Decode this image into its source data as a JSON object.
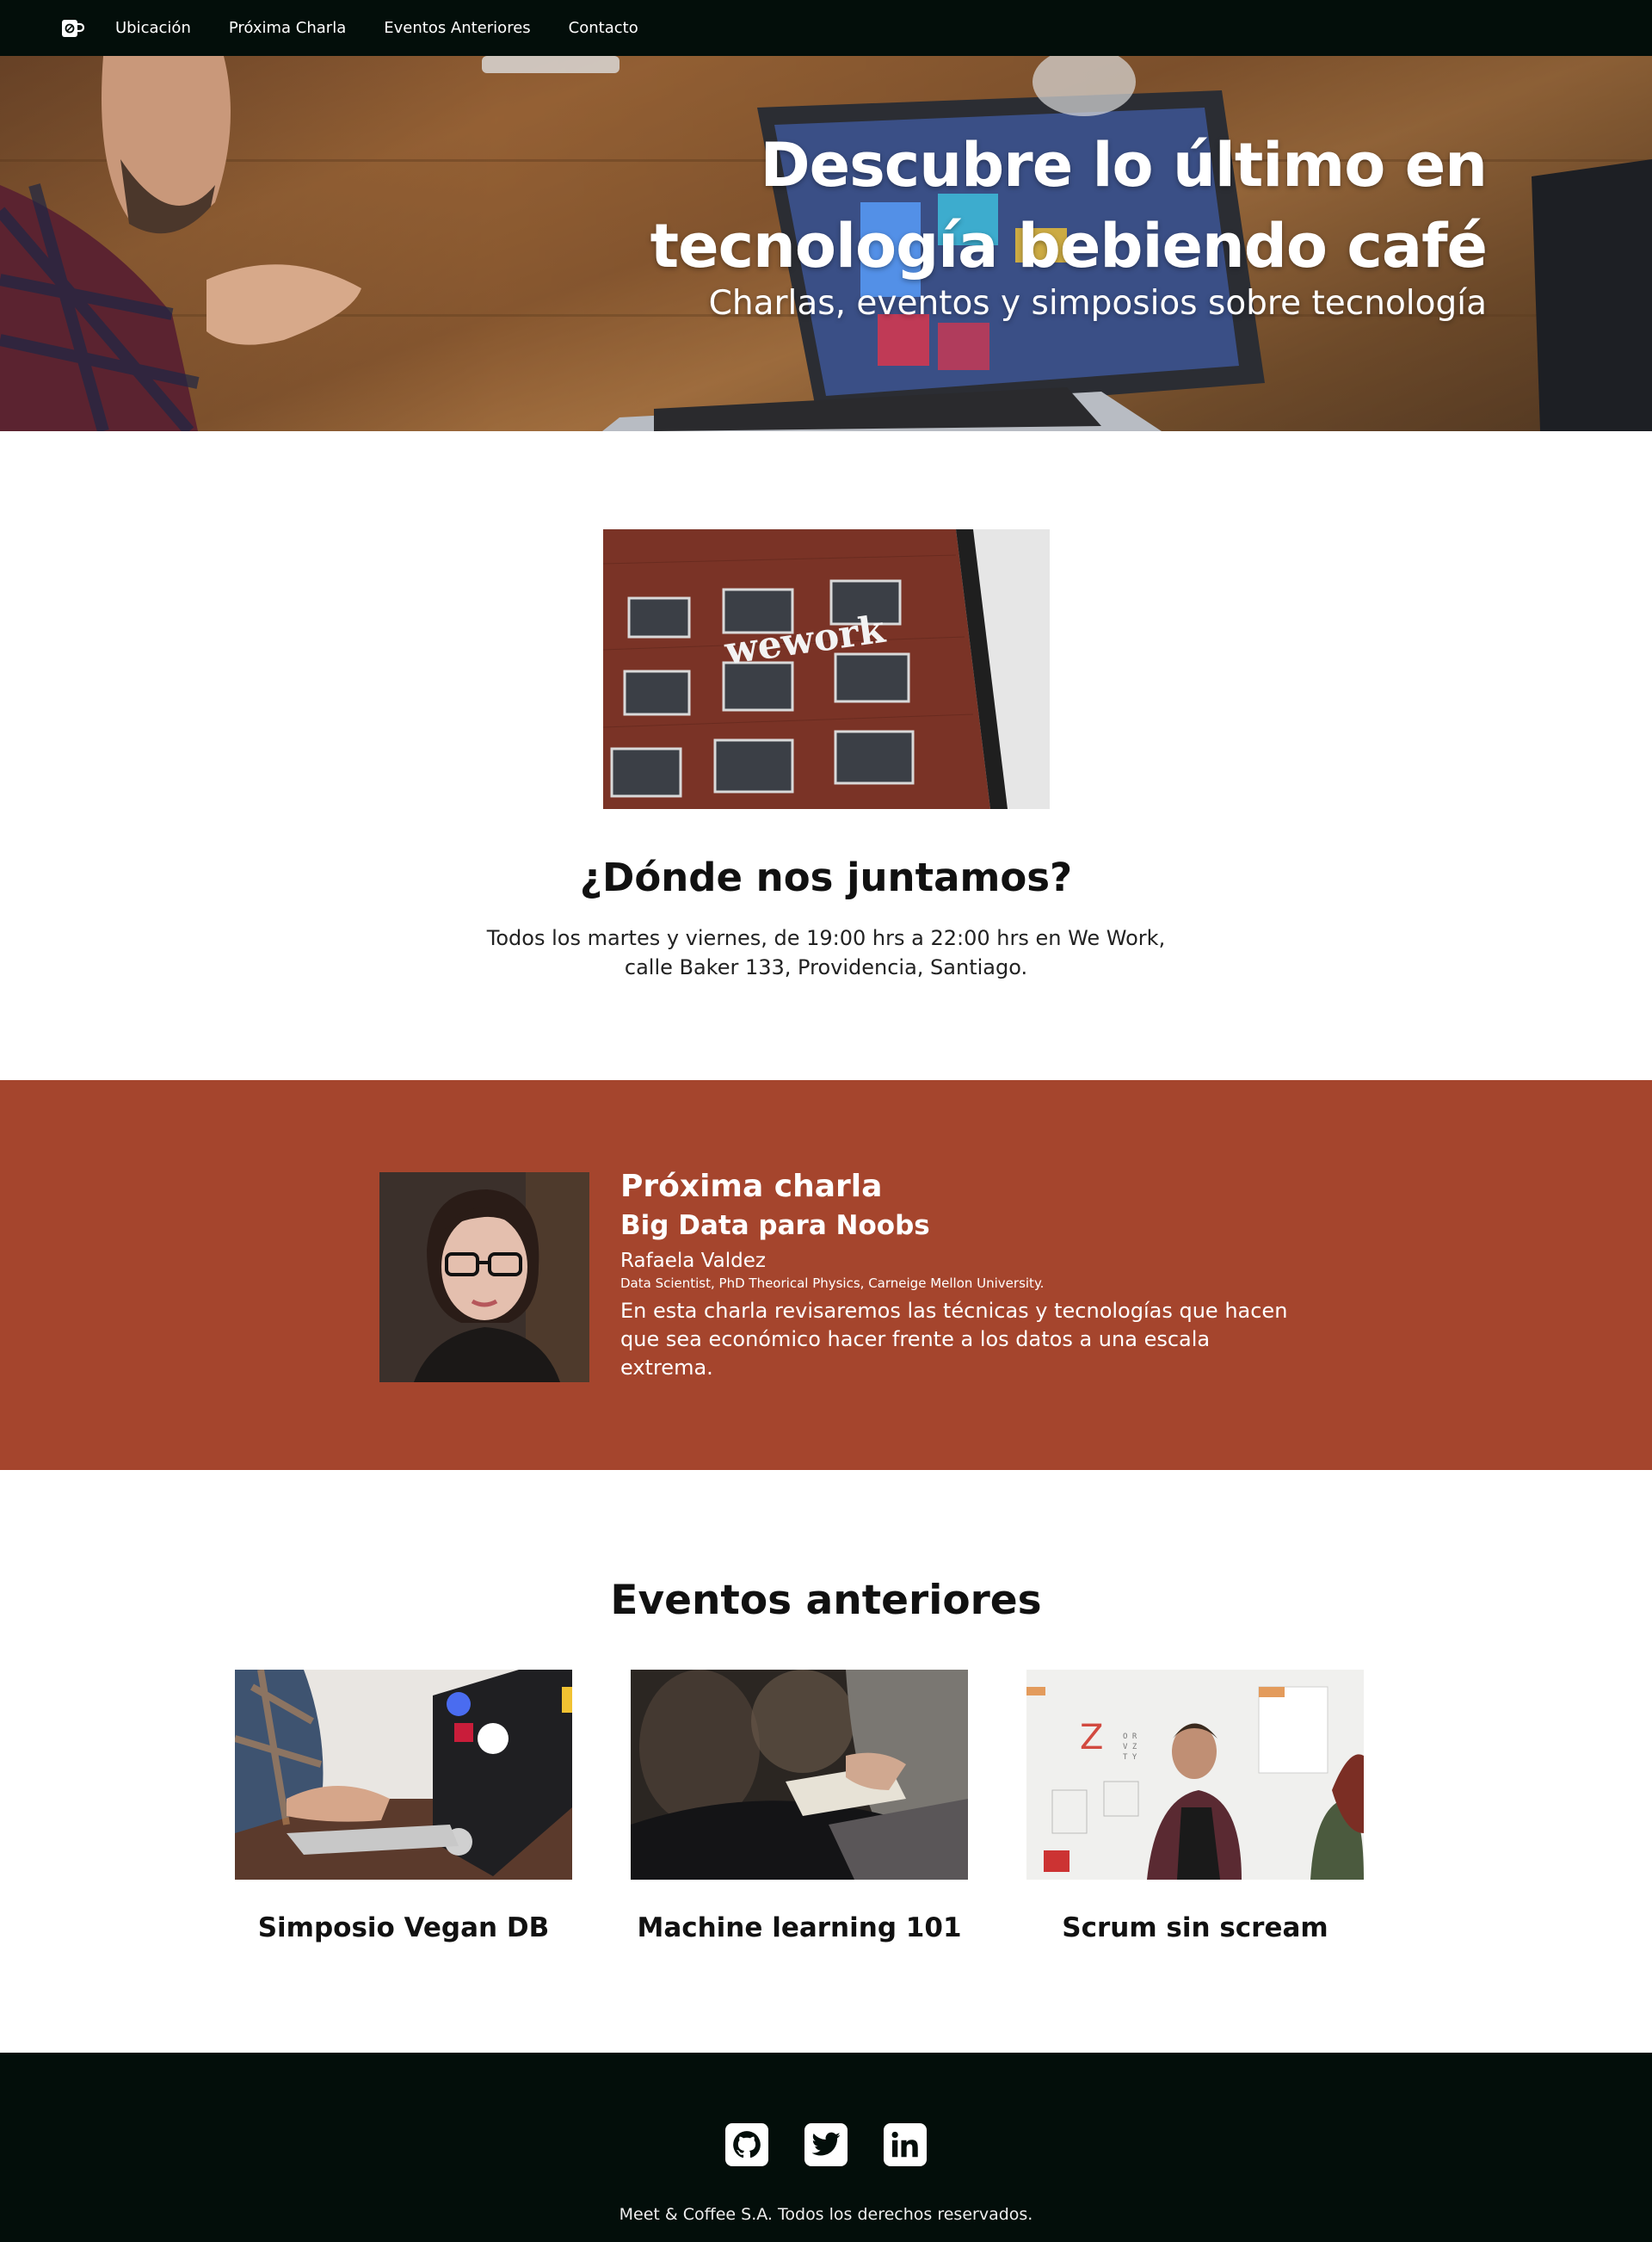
{
  "nav": {
    "brand_icon": "coffee-cup-icon",
    "links": [
      "Ubicación",
      "Próxima Charla",
      "Eventos Anteriores",
      "Contacto"
    ]
  },
  "hero": {
    "title": "Descubre lo último en tecnología bebiendo café",
    "subtitle": "Charlas, eventos y simposios sobre tecnología"
  },
  "location": {
    "photo_sign": "wework",
    "heading": "¿Dónde nos juntamos?",
    "text": "Todos los martes y viernes, de 19:00 hrs a 22:00 hrs en We Work, calle Baker 133, Providencia, Santiago."
  },
  "next_talk": {
    "heading": "Próxima charla",
    "title": "Big Data para Noobs",
    "speaker": "Rafaela Valdez",
    "credentials": "Data Scientist, PhD Theorical Physics, Carneige Mellon University.",
    "description": "En esta charla revisaremos las técnicas y tecnologías que hacen que sea económico hacer frente a los datos a una escala extrema."
  },
  "past_events": {
    "heading": "Eventos anteriores",
    "items": [
      {
        "title": "Simposio Vegan DB"
      },
      {
        "title": "Machine learning 101"
      },
      {
        "title": "Scrum sin scream"
      }
    ]
  },
  "footer": {
    "social": [
      "github-icon",
      "twitter-icon",
      "linkedin-icon"
    ],
    "copyright": "Meet & Coffee S.A. Todos los derechos reservados."
  },
  "colors": {
    "nav_bg": "#030e0a",
    "talk_bg": "#a5452d",
    "footer_bg": "#030e0a"
  }
}
